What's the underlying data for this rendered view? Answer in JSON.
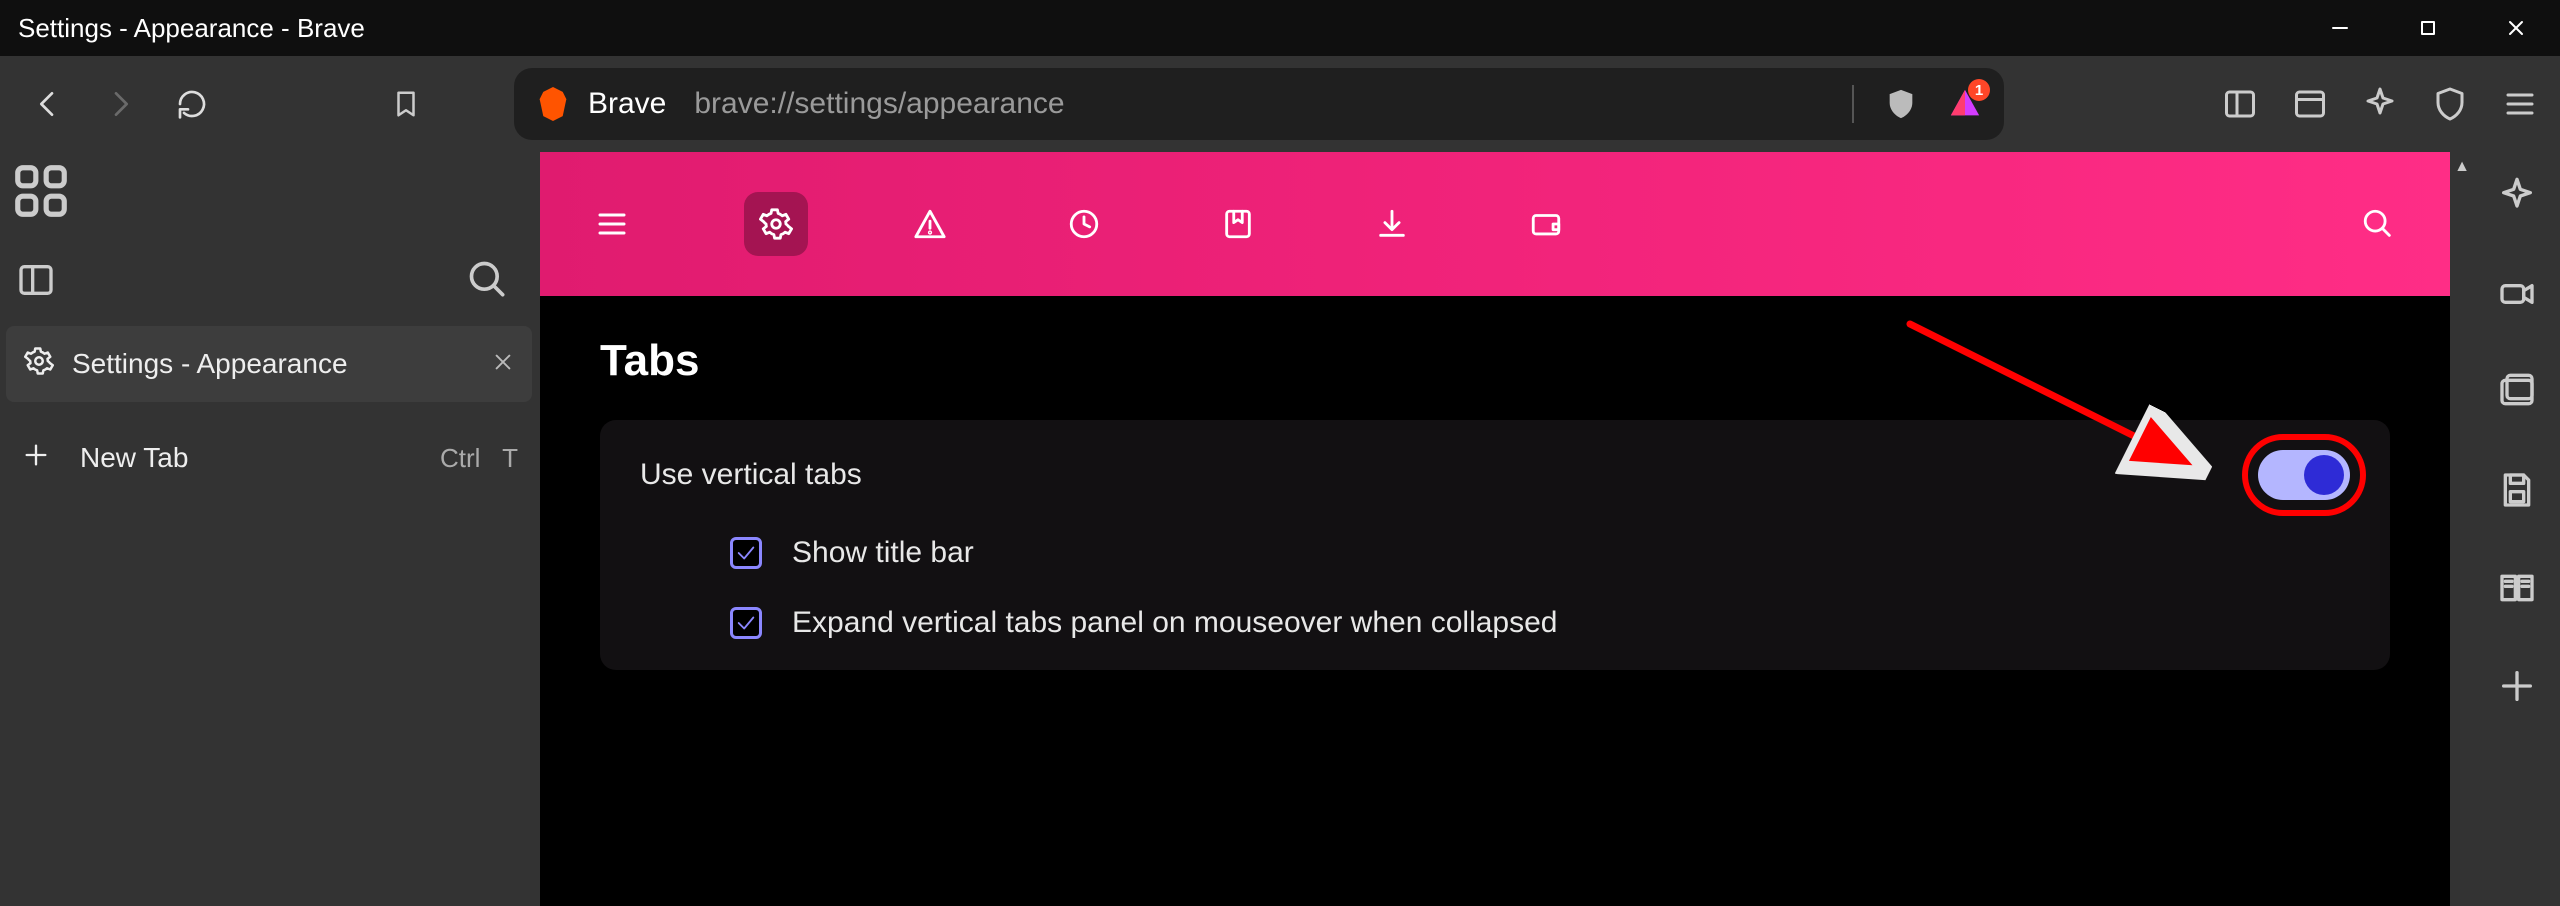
{
  "window": {
    "title": "Settings - Appearance - Brave"
  },
  "address": {
    "brand": "Brave",
    "url": "brave://settings/appearance",
    "rewards_badge": "1"
  },
  "tab": {
    "title": "Settings - Appearance"
  },
  "newtab": {
    "label": "New Tab",
    "shortcut_key1": "Ctrl",
    "shortcut_key2": "T"
  },
  "settings": {
    "section_title": "Tabs",
    "vertical_tabs": {
      "label": "Use vertical tabs",
      "enabled": true,
      "children": [
        {
          "label": "Show title bar",
          "checked": true
        },
        {
          "label": "Expand vertical tabs panel on mouseover when collapsed",
          "checked": true
        }
      ]
    }
  }
}
